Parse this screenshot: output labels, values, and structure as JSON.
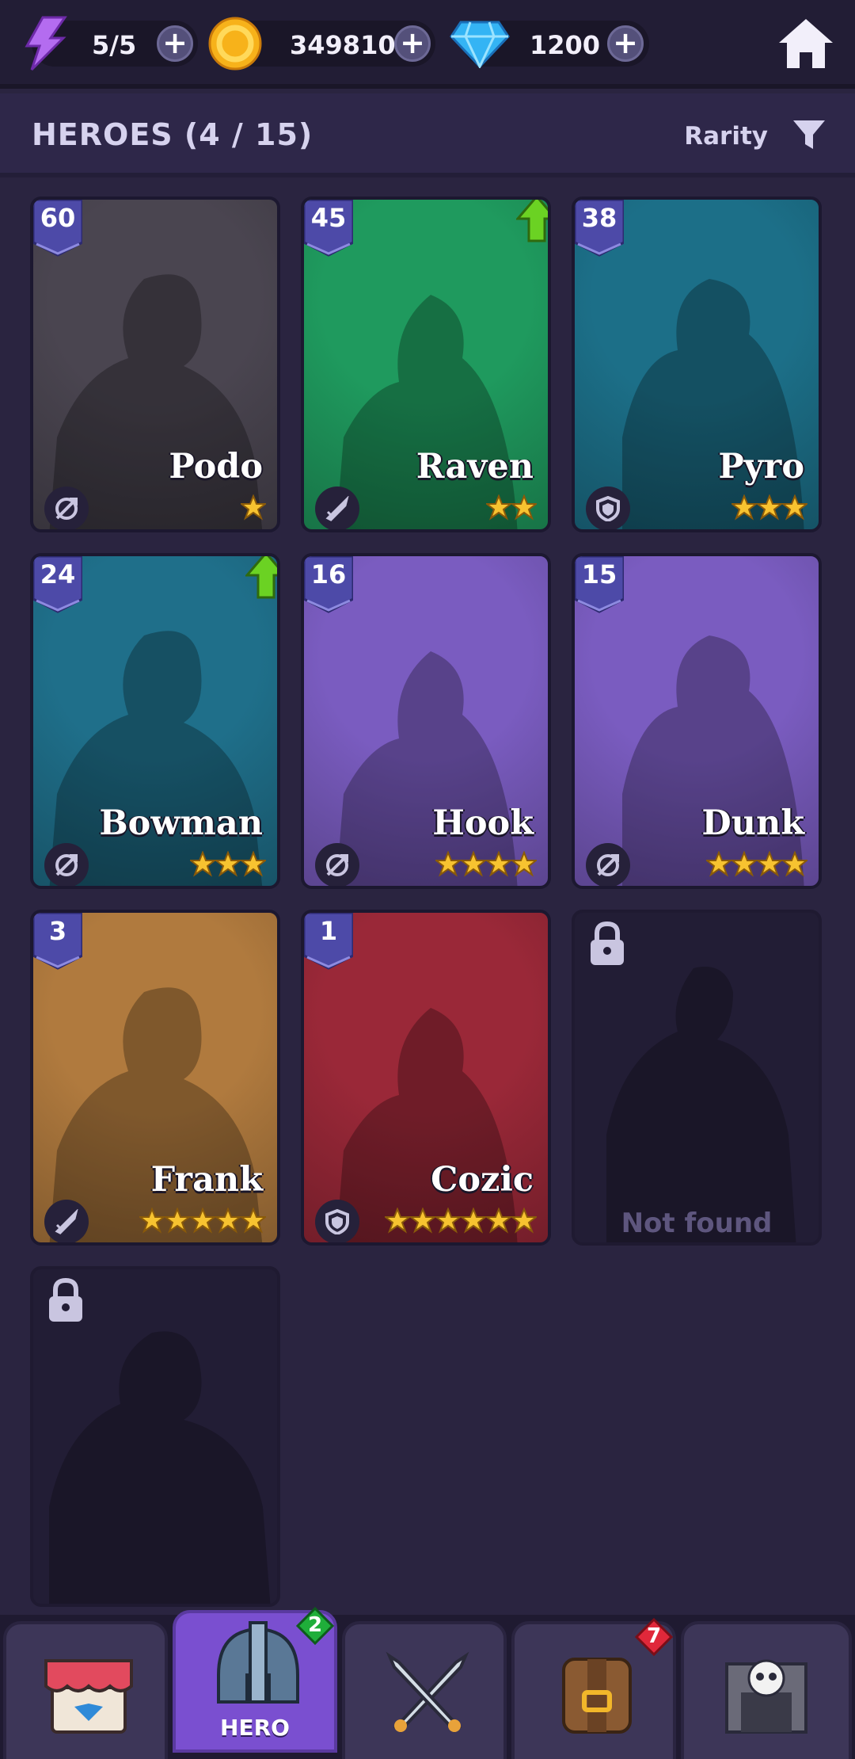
{
  "resources": {
    "energy": {
      "value": "5/5",
      "icon": "lightning-icon"
    },
    "coins": {
      "value": "349810",
      "icon": "gold-coin-icon"
    },
    "gems": {
      "value": "1200",
      "icon": "blue-gem-icon"
    }
  },
  "header": {
    "title": "HEROES (4 / 15)",
    "sort_label": "Rarity"
  },
  "heroes": [
    {
      "name": "Podo",
      "level": "60",
      "stars": 1,
      "role": "bow-icon",
      "bg": "#4a4550",
      "upgrade": false
    },
    {
      "name": "Raven",
      "level": "45",
      "stars": 2,
      "role": "sword-icon",
      "bg": "#1f9a5e",
      "upgrade": true
    },
    {
      "name": "Pyro",
      "level": "38",
      "stars": 3,
      "role": "shield-icon",
      "bg": "#1c6f88",
      "upgrade": false
    },
    {
      "name": "Bowman",
      "level": "24",
      "stars": 3,
      "role": "bow-icon",
      "bg": "#1f6f8a",
      "upgrade": true
    },
    {
      "name": "Hook",
      "level": "16",
      "stars": 4,
      "role": "bow-icon",
      "bg": "#7a5cc0",
      "upgrade": false
    },
    {
      "name": "Dunk",
      "level": "15",
      "stars": 4,
      "role": "bow-icon",
      "bg": "#7a5cc0",
      "upgrade": false
    },
    {
      "name": "Frank",
      "level": "3",
      "stars": 5,
      "role": "sword-icon",
      "bg": "#b07a3e",
      "upgrade": false
    },
    {
      "name": "Cozic",
      "level": "1",
      "stars": 6,
      "role": "shield-icon",
      "bg": "#9a2838",
      "upgrade": false
    }
  ],
  "locked": {
    "not_found_label": "Not found"
  },
  "nav": {
    "tabs": [
      {
        "id": "shop",
        "icon": "shop-icon",
        "label": ""
      },
      {
        "id": "hero",
        "icon": "helmet-icon",
        "label": "HERO",
        "badge": "2"
      },
      {
        "id": "battle",
        "icon": "crossed-swords-icon",
        "label": ""
      },
      {
        "id": "inventory",
        "icon": "backpack-icon",
        "label": "",
        "badge": "7"
      },
      {
        "id": "dungeon",
        "icon": "skull-gate-icon",
        "label": ""
      }
    ]
  },
  "colors": {
    "background": "#2a2440",
    "accent": "#7a4fd0",
    "star": "#f7c330",
    "level_badge": "#4d4aa8",
    "upgrade_arrow": "#6bd223",
    "badge_green": "#1fae3a",
    "badge_red": "#e0283a"
  }
}
